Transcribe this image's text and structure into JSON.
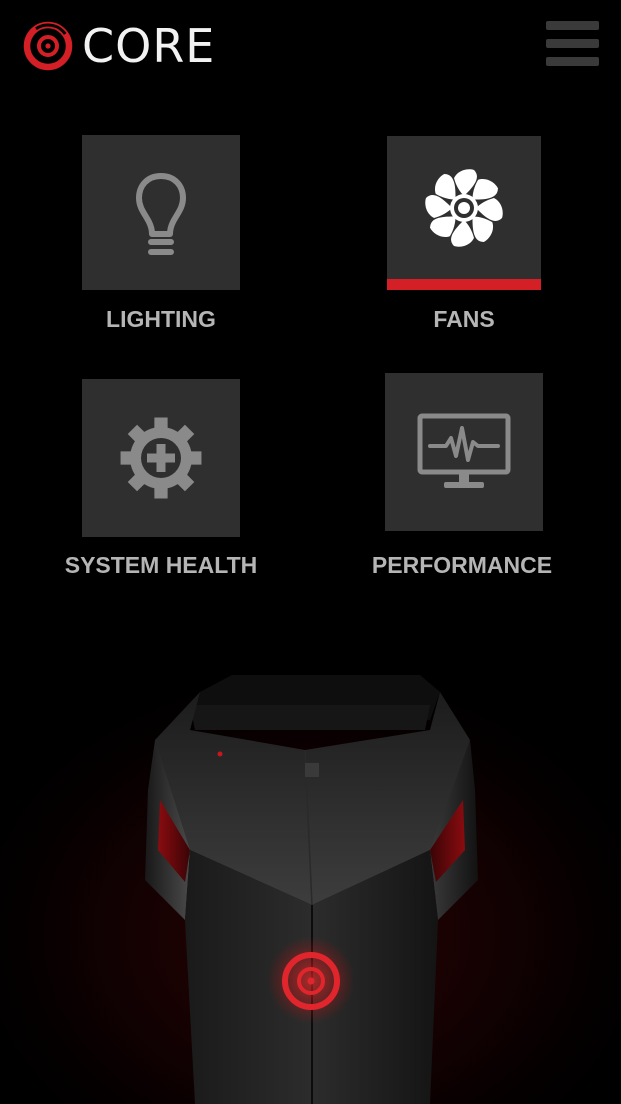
{
  "header": {
    "brand_name": "CORE",
    "logo_icon": "core-ring-logo-icon",
    "menu_icon": "hamburger-menu-icon"
  },
  "colors": {
    "background": "#000000",
    "tile": "#2f2f2f",
    "accent": "#d51f27",
    "label": "#b5b5b5",
    "icon": "#8a8a8a"
  },
  "tiles": [
    {
      "label": "LIGHTING",
      "icon": "lightbulb-icon",
      "active": false
    },
    {
      "label": "FANS",
      "icon": "fan-icon",
      "active": true
    },
    {
      "label": "SYSTEM HEALTH",
      "icon": "gear-plus-icon",
      "active": false
    },
    {
      "label": "PERFORMANCE",
      "icon": "monitor-heartbeat-icon",
      "active": false
    }
  ],
  "hero": {
    "image": "desktop-pc-case",
    "logo_icon": "case-ring-logo-icon"
  }
}
